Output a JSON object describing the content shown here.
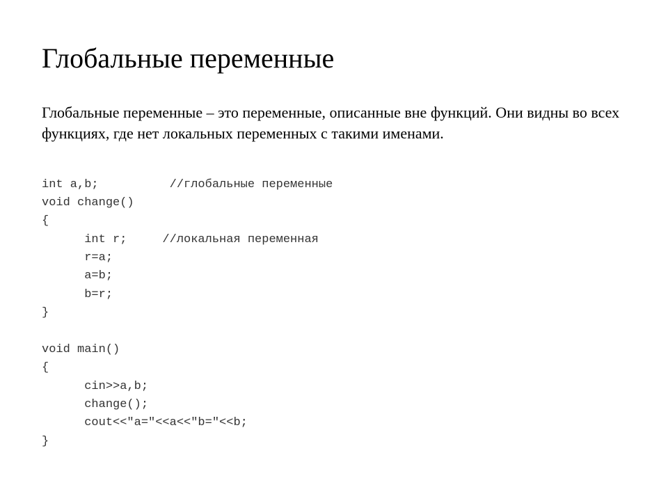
{
  "title": "Глобальные переменные",
  "description": "Глобальные переменные – это переменные, описанные вне функций. Они видны во всех функциях, где нет локальных переменных с такими именами.",
  "code": {
    "line1": "int a,b;          //глобальные переменные",
    "line2": "void change()",
    "line3": "{",
    "line4": "      int r;     //локальная переменная",
    "line5": "      r=a;",
    "line6": "      a=b;",
    "line7": "      b=r;",
    "line8": "}",
    "line9": "",
    "line10": "void main()",
    "line11": "{",
    "line12": "      cin>>a,b;",
    "line13": "      change();",
    "line14": "      cout<<\"a=\"<<a<<\"b=\"<<b;",
    "line15": "}"
  }
}
